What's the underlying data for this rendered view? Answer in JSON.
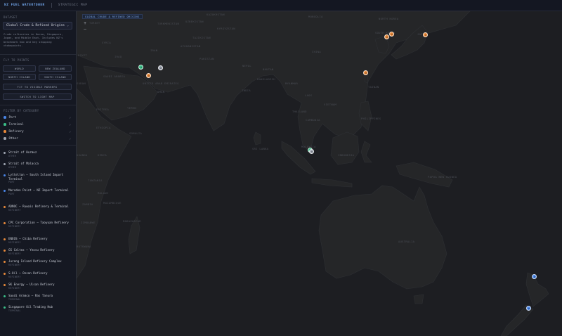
{
  "header": {
    "brand": "NZ FUEL WATERTOWER",
    "tab": "STRATEGIC MAP"
  },
  "sidebar": {
    "dataset_label": "DATASET",
    "dataset_value": "Global Crude & Refined Origins",
    "dataset_description": "Crude refineries in Korea, Singapore, Japan, and Middle East. Includes NZ's benchmark hub and key shipping chokepoints.",
    "flyto_label": "FLY TO POINTS",
    "flyto_buttons": [
      "WORLD",
      "NEW ZEALAND",
      "NORTH ISLAND",
      "SOUTH ISLAND"
    ],
    "fit_button": "FIT TO VISIBLE MARKERS",
    "light_button": "SWITCH TO LIGHT MAP",
    "filter_label": "FILTER BY CATEGORY",
    "categories": [
      {
        "name": "Port",
        "color": "#4a86e8"
      },
      {
        "name": "Terminal",
        "color": "#3bbf88"
      },
      {
        "name": "Refinery",
        "color": "#e8893a"
      },
      {
        "name": "Other",
        "color": "#a0a6b2"
      }
    ],
    "entries": [
      {
        "name": "Strait of Hormuz",
        "type": "OTHER",
        "color": "#a0a6b2"
      },
      {
        "name": "Strait of Malacca",
        "type": "OTHER",
        "color": "#a0a6b2"
      },
      {
        "name": "Lyttelton — South Island Import Terminal",
        "type": "PORT",
        "color": "#4a86e8"
      },
      {
        "name": "Marsden Point — NZ Import Terminal",
        "type": "PORT",
        "color": "#4a86e8"
      },
      {
        "name": "ADNOC — Ruwais Refinery & Terminal",
        "type": "REFINERY",
        "color": "#e8893a"
      },
      {
        "name": "CPC Corporation — Taoyuan Refinery",
        "type": "REFINERY",
        "color": "#e8893a"
      },
      {
        "name": "ENEOS — Chiba Refinery",
        "type": "REFINERY",
        "color": "#e8893a"
      },
      {
        "name": "GS Caltex — Yeosu Refinery",
        "type": "REFINERY",
        "color": "#e8893a"
      },
      {
        "name": "Jurong Island Refinery Complex",
        "type": "REFINERY",
        "color": "#e8893a"
      },
      {
        "name": "S-Oil — Onsan Refinery",
        "type": "REFINERY",
        "color": "#e8893a"
      },
      {
        "name": "SK Energy — Ulsan Refinery",
        "type": "REFINERY",
        "color": "#e8893a"
      },
      {
        "name": "Saudi Aramco — Ras Tanura",
        "type": "TERMINAL",
        "color": "#3bbf88"
      },
      {
        "name": "Singapore Oil Trading Hub",
        "type": "TERMINAL",
        "color": "#3bbf88"
      }
    ]
  },
  "map": {
    "tag": "GLOBAL CRUDE & REFINED ORIGINS",
    "zoom_in": "+",
    "zoom_out": "—",
    "labels": [
      "TURKEY",
      "SYRIA",
      "IRAQ",
      "IRAN",
      "TURKMENISTAN",
      "UZBEKISTAN",
      "KAZAKHSTAN",
      "AFGHANISTAN",
      "PAKISTAN",
      "INDIA",
      "NEPAL",
      "BHUTAN",
      "BANGLADESH",
      "MYANMAR",
      "LAOS",
      "THAILAND",
      "CAMBODIA",
      "VIETNAM",
      "PHILIPPINES",
      "MALAYSIA",
      "INDONESIA",
      "PAPUA NEW GUINEA",
      "AUSTRALIA",
      "SAUDI ARABIA",
      "YEMEN",
      "OMAN",
      "UNITED ARAB EMIRATES",
      "ERITREA",
      "ETHIOPIA",
      "SOMALIA",
      "KENYA",
      "UGANDA",
      "TANZANIA",
      "MOZAMBIQUE",
      "MADAGASCAR",
      "ZAMBIA",
      "MALAWI",
      "ZIMBABWE",
      "BOTSWANA",
      "EGYPT",
      "SUDAN",
      "JAPAN",
      "NORTH KOREA",
      "SOUTH KOREA",
      "SRI LANKA",
      "CHINA",
      "MONGOLIA",
      "TAIWAN",
      "TAJIKISTAN",
      "KYRGYZSTAN"
    ],
    "markers": [
      {
        "category": "Terminal",
        "color": "#3bbf88"
      },
      {
        "category": "Other",
        "color": "#a0a6b2"
      },
      {
        "category": "Refinery",
        "color": "#e8893a"
      },
      {
        "category": "Refinery",
        "color": "#e8893a"
      },
      {
        "category": "Refinery",
        "color": "#e8893a"
      },
      {
        "category": "Refinery",
        "color": "#e8893a"
      },
      {
        "category": "Refinery",
        "color": "#e8893a"
      },
      {
        "category": "Terminal",
        "color": "#3bbf88"
      },
      {
        "category": "Other",
        "color": "#a0a6b2"
      },
      {
        "category": "Port",
        "color": "#4a86e8"
      },
      {
        "category": "Port",
        "color": "#4a86e8"
      }
    ]
  }
}
